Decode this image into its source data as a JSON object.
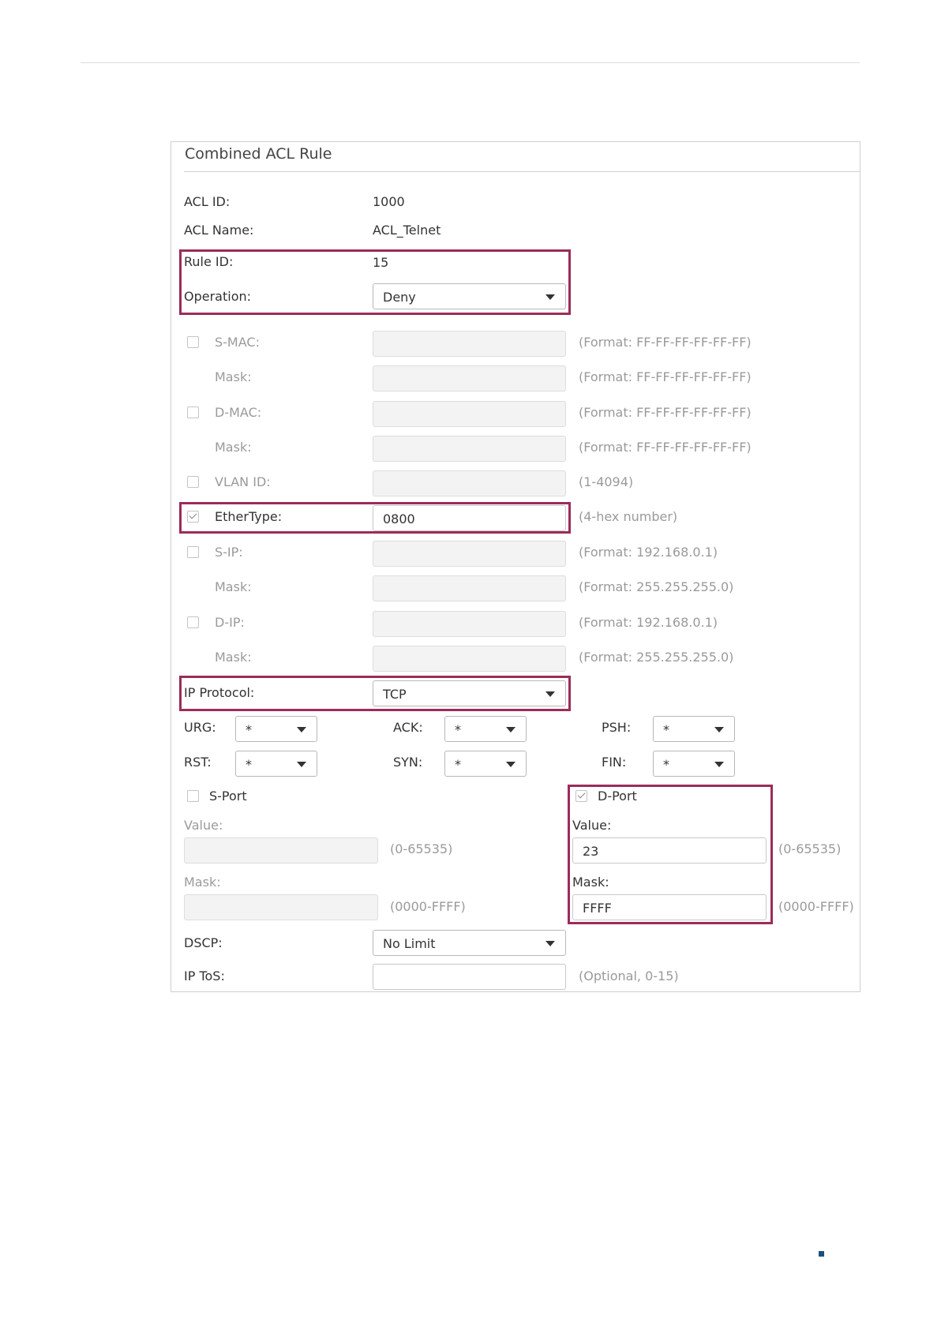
{
  "panel": {
    "title": "Combined ACL Rule"
  },
  "acl_id": {
    "label": "ACL ID:",
    "value": "1000"
  },
  "acl_name": {
    "label": "ACL Name:",
    "value": "ACL_Telnet"
  },
  "rule_id": {
    "label": "Rule ID:",
    "value": "15"
  },
  "operation": {
    "label": "Operation:",
    "value": "Deny"
  },
  "s_mac": {
    "label": "S-MAC:",
    "hint": "(Format: FF-FF-FF-FF-FF-FF)",
    "mask_label": "Mask:",
    "mask_hint": "(Format: FF-FF-FF-FF-FF-FF)"
  },
  "d_mac": {
    "label": "D-MAC:",
    "hint": "(Format: FF-FF-FF-FF-FF-FF)",
    "mask_label": "Mask:",
    "mask_hint": "(Format: FF-FF-FF-FF-FF-FF)"
  },
  "vlan_id": {
    "label": "VLAN ID:",
    "hint": "(1-4094)"
  },
  "ethertype": {
    "label": "EtherType:",
    "value": "0800",
    "hint": "(4-hex number)",
    "checked": true
  },
  "s_ip": {
    "label": "S-IP:",
    "hint": "(Format: 192.168.0.1)",
    "mask_label": "Mask:",
    "mask_hint": "(Format: 255.255.255.0)"
  },
  "d_ip": {
    "label": "D-IP:",
    "hint": "(Format: 192.168.0.1)",
    "mask_label": "Mask:",
    "mask_hint": "(Format: 255.255.255.0)"
  },
  "ip_protocol": {
    "label": "IP Protocol:",
    "value": "TCP"
  },
  "flags": {
    "urg": {
      "label": "URG:",
      "value": "*"
    },
    "ack": {
      "label": "ACK:",
      "value": "*"
    },
    "psh": {
      "label": "PSH:",
      "value": "*"
    },
    "rst": {
      "label": "RST:",
      "value": "*"
    },
    "syn": {
      "label": "SYN:",
      "value": "*"
    },
    "fin": {
      "label": "FIN:",
      "value": "*"
    }
  },
  "s_port": {
    "label": "S-Port",
    "value_label": "Value:",
    "value_hint": "(0-65535)",
    "mask_label": "Mask:",
    "mask_hint": "(0000-FFFF)",
    "checked": false
  },
  "d_port": {
    "label": "D-Port",
    "value_label": "Value:",
    "value": "23",
    "value_hint": "(0-65535)",
    "mask_label": "Mask:",
    "mask": "FFFF",
    "mask_hint": "(0000-FFFF)",
    "checked": true
  },
  "dscp": {
    "label": "DSCP:",
    "value": "No Limit"
  },
  "ip_tos": {
    "label": "IP ToS:",
    "hint": "(Optional, 0-15)"
  },
  "colors": {
    "highlight": "#9c2b5b",
    "footer_mark": "#1f4e79"
  }
}
